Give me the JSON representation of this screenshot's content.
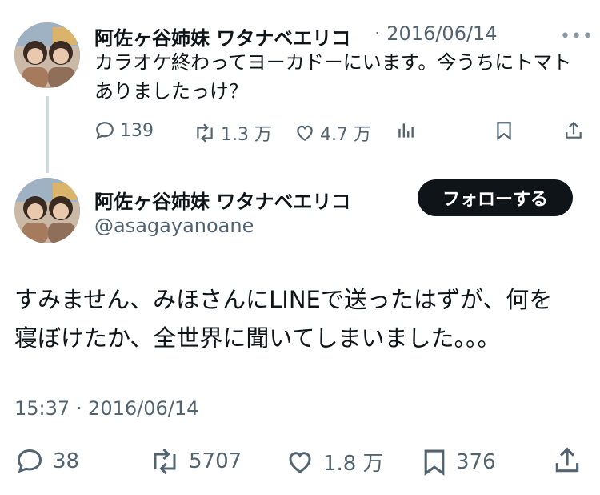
{
  "reply_tweet": {
    "author_name": "阿佐ヶ谷姉妹 ワタナベエリコ",
    "date": "· 2016/06/14",
    "more_label": "•••",
    "text": "カラオケ終わってヨーカドーにいます。今うちにトマトありましたっけ？",
    "stats": {
      "replies": "139",
      "retweets": "1.3 万",
      "likes": "4.7 万"
    },
    "icons": [
      "reply-icon",
      "retweet-icon",
      "like-icon",
      "views-icon",
      "bookmark-icon",
      "share-icon"
    ]
  },
  "main_tweet": {
    "author_name": "阿佐ヶ谷姉妹 ワタナベエリコ",
    "handle": "@asagayanoane",
    "follow_label": "フォローする",
    "text_line1": "すみません、みほさんにLINEで送ったはずが、何を",
    "text_line2": "寝ぼけたか、全世界に聞いてしまいました。。。",
    "timestamp": "15:37 · 2016/06/14",
    "stats": {
      "replies": "38",
      "retweets": "5707",
      "likes": "1.8 万",
      "bookmarks": "376"
    },
    "icons": [
      "reply-icon",
      "retweet-icon",
      "like-icon",
      "bookmark-icon",
      "share-icon"
    ]
  },
  "colors": {
    "text": "#0f1419",
    "secondary": "#536471",
    "thread_line": "#cfd9de",
    "button": "#0f1419"
  }
}
